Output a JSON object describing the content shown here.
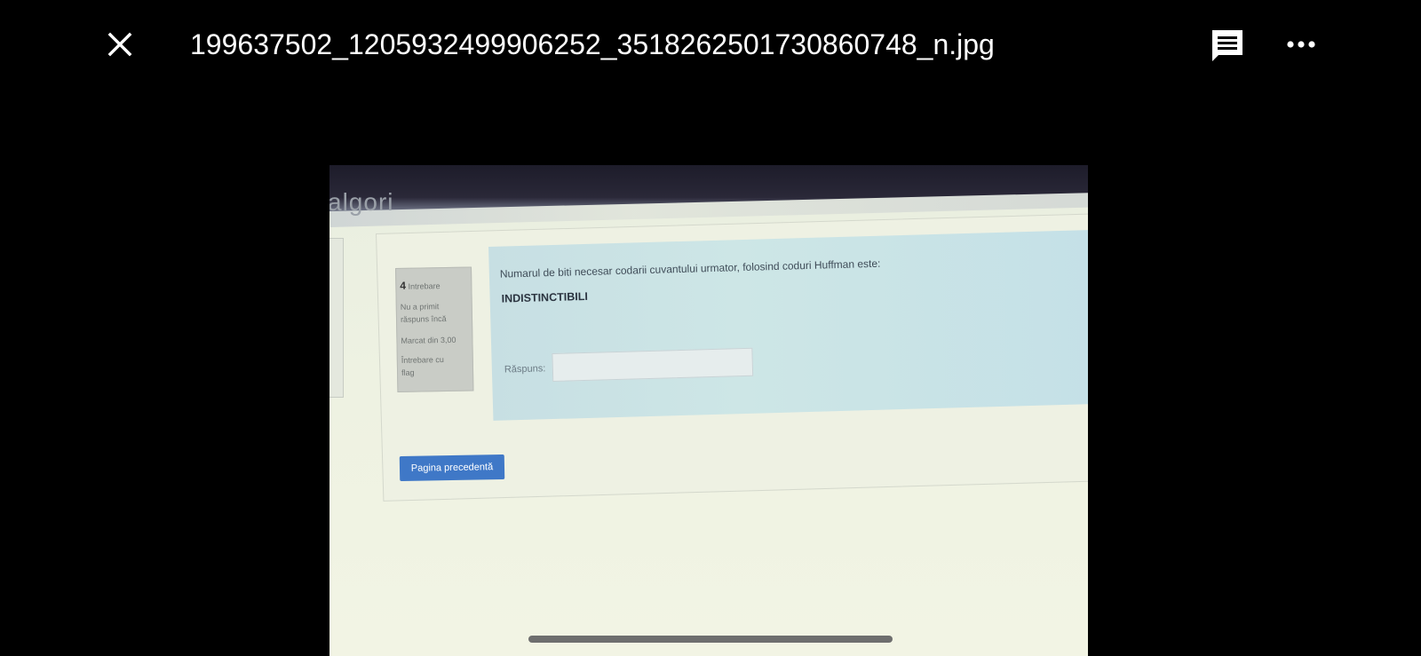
{
  "viewer": {
    "filename": "199637502_1205932499906252_3518262501730860748_n.jpg"
  },
  "photo": {
    "heading_fragment": "algori",
    "question_info": {
      "number": "4",
      "label": "Intrebare",
      "status_line1": "Nu a primit",
      "status_line2": "răspuns încă",
      "marks": "Marcat din 3,00",
      "flag_line1": "Întrebare cu",
      "flag_line2": "flag"
    },
    "question": {
      "text": "Numarul de biti necesar codarii cuvantului urmator, folosind coduri Huffman este:",
      "word": "INDISTINCTIBILI",
      "answer_label": "Răspuns:",
      "answer_value": ""
    },
    "prev_button_label": "Pagina precedentă"
  },
  "icons": {
    "close": "close-icon",
    "comment": "comment-icon",
    "more": "more-icon"
  }
}
